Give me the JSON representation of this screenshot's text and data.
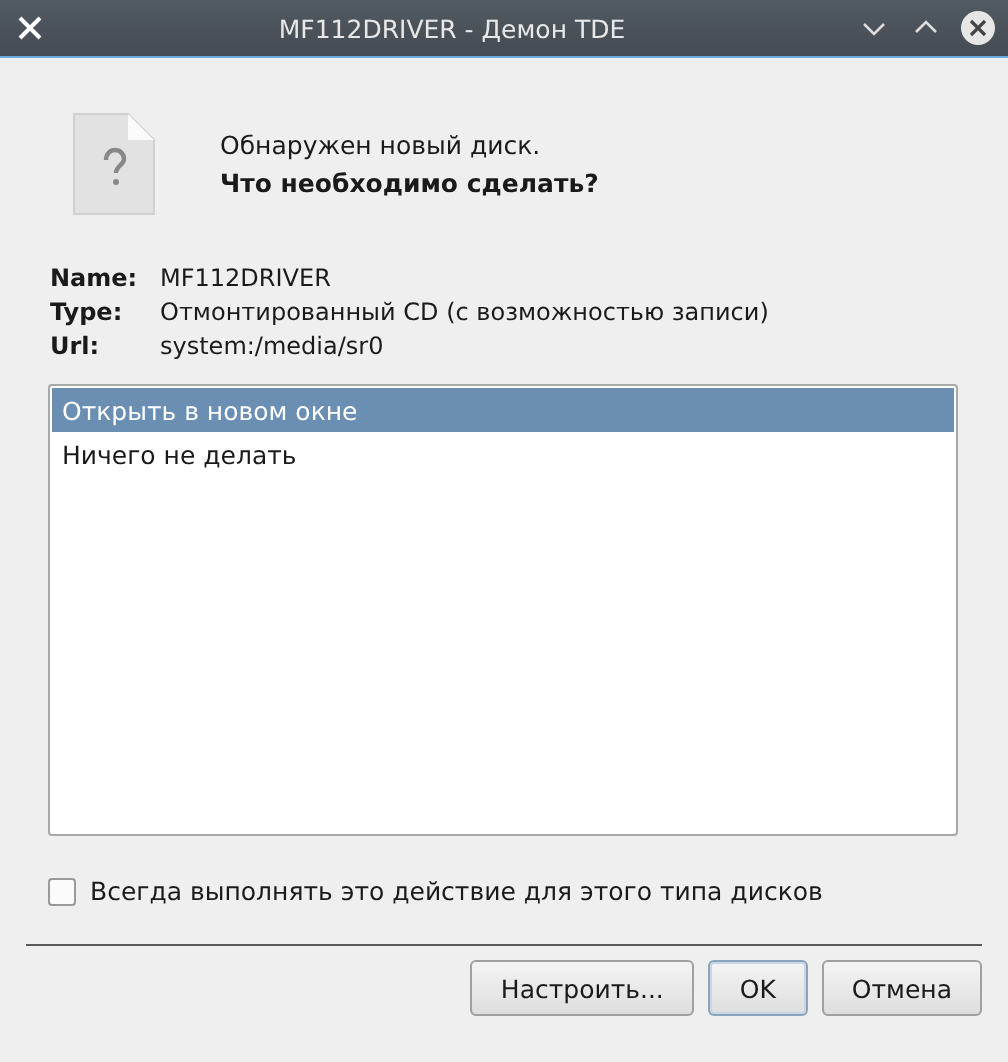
{
  "window": {
    "title": "MF112DRIVER - Демон TDE"
  },
  "message": {
    "line": "Обнаружен новый диск.",
    "question": "Что необходимо сделать?"
  },
  "info": [
    {
      "label": "Name:",
      "value": "MF112DRIVER"
    },
    {
      "label": "Type:",
      "value": "Отмонтированный CD (с возможностью записи)"
    },
    {
      "label": "Url:",
      "value": "system:/media/sr0"
    }
  ],
  "actions": [
    {
      "label": "Открыть в новом окне",
      "selected": true
    },
    {
      "label": "Ничего не делать",
      "selected": false
    }
  ],
  "always": {
    "label": "Всегда выполнять это действие для этого типа дисков",
    "checked": false
  },
  "buttons": [
    {
      "label": "Настроить...",
      "default": false
    },
    {
      "label": "OK",
      "default": true
    },
    {
      "label": "Отмена",
      "default": false
    }
  ]
}
